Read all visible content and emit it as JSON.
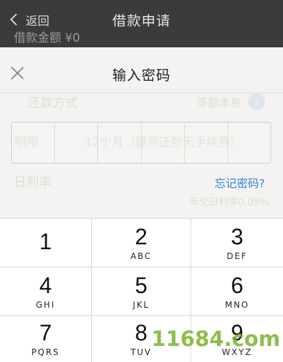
{
  "nav": {
    "back_label": "返回",
    "title": "借款申请"
  },
  "background": {
    "amount_label": "借款金额",
    "amount_value": "¥0",
    "repay_label": "还款方式",
    "repay_value": "等额本息",
    "term_label": "期限",
    "term_value": "12个月（提前还款无手续费）",
    "rate_label": "日利率",
    "note": "年化日利率0.05%"
  },
  "sheet": {
    "title": "输入密码",
    "password_cells": 6,
    "forgot_label": "忘记密码?"
  },
  "keypad": [
    {
      "digit": "1",
      "letters": ""
    },
    {
      "digit": "2",
      "letters": "ABC"
    },
    {
      "digit": "3",
      "letters": "DEF"
    },
    {
      "digit": "4",
      "letters": "GHI"
    },
    {
      "digit": "5",
      "letters": "JKL"
    },
    {
      "digit": "6",
      "letters": "MNO"
    },
    {
      "digit": "7",
      "letters": "PQRS"
    },
    {
      "digit": "8",
      "letters": "TUV"
    },
    {
      "digit": "9",
      "letters": "WXYZ"
    }
  ],
  "watermark": "11684.com",
  "colors": {
    "accent_link": "#2f86d8",
    "navbar": "#3b3b3b",
    "watermark": "#7bb32e"
  }
}
